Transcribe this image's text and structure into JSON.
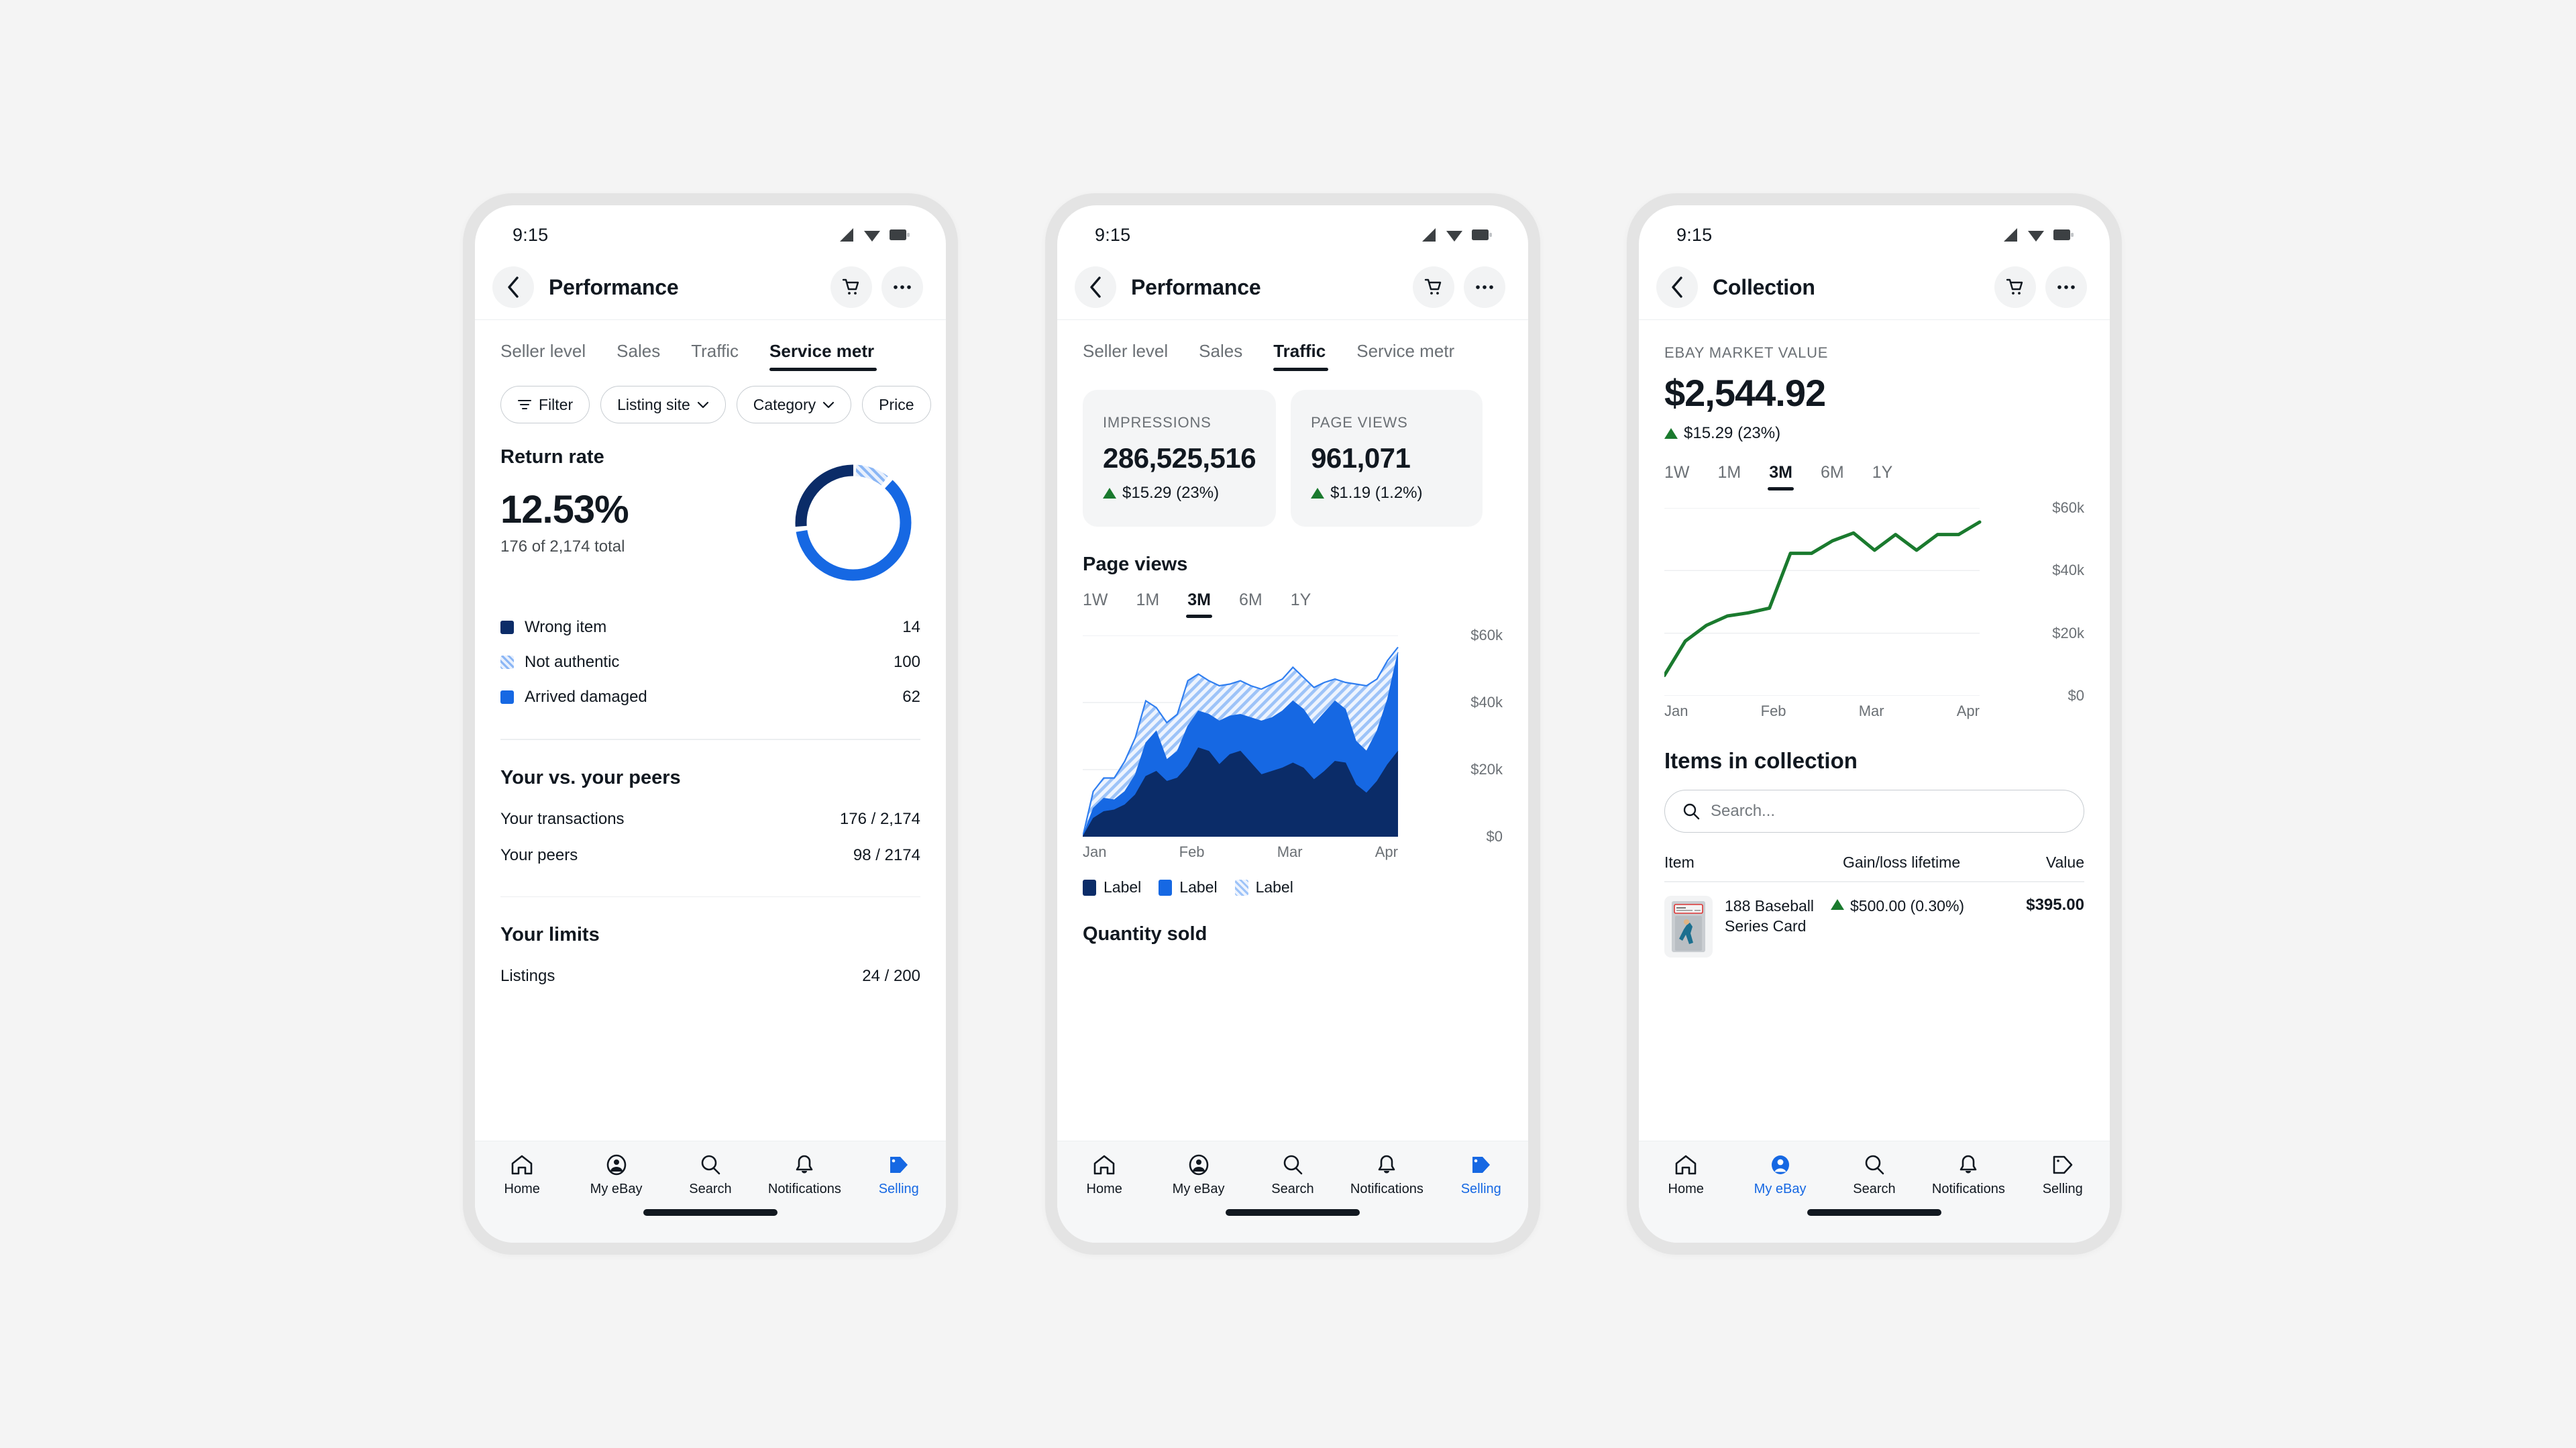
{
  "status_bar": {
    "time": "9:15",
    "icons": [
      "signal-icon",
      "wifi-icon",
      "battery-icon"
    ]
  },
  "colors": {
    "navy": "#0b2c68",
    "blue": "#1668e3",
    "hatch_light": "#cfe0fb",
    "green": "#1a7a2e",
    "text": "#111820",
    "muted": "#6b7075"
  },
  "bottom_nav": {
    "items": [
      {
        "label": "Home",
        "icon": "home-icon"
      },
      {
        "label": "My eBay",
        "icon": "account-icon"
      },
      {
        "label": "Search",
        "icon": "search-icon"
      },
      {
        "label": "Notifications",
        "icon": "bell-icon"
      },
      {
        "label": "Selling",
        "icon": "tag-icon"
      }
    ],
    "active_phone1": "Selling",
    "active_phone2": "Selling",
    "active_phone3": "My eBay"
  },
  "phone1": {
    "appbar": {
      "back": "back-icon",
      "title": "Performance",
      "cart": "cart-icon",
      "more": "more-icon"
    },
    "tabs": [
      {
        "label": "Seller level",
        "active": false
      },
      {
        "label": "Sales",
        "active": false
      },
      {
        "label": "Traffic",
        "active": false
      },
      {
        "label": "Service metr",
        "active": true
      }
    ],
    "chips": [
      {
        "label": "Filter",
        "icon": "filter-icon",
        "caret": false
      },
      {
        "label": "Listing site",
        "icon": "",
        "caret": true
      },
      {
        "label": "Category",
        "icon": "",
        "caret": true
      },
      {
        "label": "Price",
        "icon": "",
        "caret": false
      }
    ],
    "return_rate": {
      "title": "Return rate",
      "percent": "12.53%",
      "subtitle": "176 of 2,174 total",
      "legend": [
        {
          "label": "Wrong item",
          "value": "14",
          "swatch": "navy"
        },
        {
          "label": "Not authentic",
          "value": "100",
          "swatch": "hatch"
        },
        {
          "label": "Arrived damaged",
          "value": "62",
          "swatch": "blue"
        }
      ]
    },
    "peers": {
      "title": "Your vs. your peers",
      "rows": [
        {
          "label": "Your transactions",
          "value": "176 / 2,174"
        },
        {
          "label": "Your peers",
          "value": "98 / 2174"
        }
      ]
    },
    "limits": {
      "title": "Your limits",
      "rows": [
        {
          "label": "Listings",
          "value": "24 / 200"
        }
      ]
    },
    "chart_data": {
      "type": "pie",
      "title": "Return rate",
      "labels": [
        "Wrong item",
        "Not authentic",
        "Arrived damaged"
      ],
      "values": [
        14,
        100,
        62
      ],
      "total": 176,
      "total_transactions": 2174,
      "percent_of_total": 12.53,
      "colors": [
        "#0b2c68",
        "#cfe0fb",
        "#1668e3"
      ],
      "donut": true
    }
  },
  "phone2": {
    "appbar": {
      "back": "back-icon",
      "title": "Performance",
      "cart": "cart-icon",
      "more": "more-icon"
    },
    "tabs": [
      {
        "label": "Seller level",
        "active": false
      },
      {
        "label": "Sales",
        "active": false
      },
      {
        "label": "Traffic",
        "active": true
      },
      {
        "label": "Service metr",
        "active": false
      }
    ],
    "stats": [
      {
        "label": "IMPRESSIONS",
        "value": "286,525,516",
        "delta": "$15.29 (23%)",
        "direction": "up"
      },
      {
        "label": "PAGE VIEWS",
        "value": "961,071",
        "delta": "$1.19 (1.2%)",
        "direction": "up"
      }
    ],
    "page_views": {
      "title": "Page views",
      "ranges": [
        "1W",
        "1M",
        "3M",
        "6M",
        "1Y"
      ],
      "active_range": "3M",
      "legend": [
        {
          "label": "Label",
          "swatch": "navy"
        },
        {
          "label": "Label",
          "swatch": "blue"
        },
        {
          "label": "Label",
          "swatch": "hatch"
        }
      ]
    },
    "quantity_sold": {
      "title": "Quantity sold"
    },
    "chart_data": {
      "type": "area",
      "title": "Page views",
      "stacked": true,
      "xlabel": "",
      "ylabel": "",
      "ylim": [
        0,
        60000
      ],
      "yticks": [
        0,
        20000,
        40000,
        60000
      ],
      "ytick_labels": [
        "$0",
        "$20k",
        "$40k",
        "$60k"
      ],
      "xtick_labels": [
        "Jan",
        "Feb",
        "Mar",
        "Apr"
      ],
      "grid": true,
      "legend_position": "below",
      "x": [
        0,
        1,
        2,
        3,
        4,
        5,
        6,
        7,
        8,
        9,
        10,
        11,
        12,
        13,
        14,
        15,
        16,
        17,
        18,
        19,
        20,
        21,
        22,
        23,
        24,
        25,
        26,
        27,
        28,
        29,
        30
      ],
      "series": [
        {
          "name": "Label",
          "color": "#0b2c68",
          "values": [
            0,
            5500,
            7500,
            8000,
            9500,
            12500,
            18000,
            19500,
            16500,
            17500,
            21000,
            26500,
            25500,
            21500,
            24500,
            25500,
            22000,
            18500,
            19500,
            20500,
            22000,
            20500,
            17000,
            19500,
            22500,
            22000,
            15500,
            13000,
            16500,
            21500,
            25500
          ]
        },
        {
          "name": "Label",
          "color": "#1668e3",
          "values": [
            0,
            8500,
            11500,
            11000,
            13500,
            18500,
            28000,
            31500,
            23000,
            25500,
            33000,
            37500,
            36500,
            34500,
            36000,
            36500,
            35500,
            34500,
            35500,
            37500,
            40500,
            38000,
            33500,
            37000,
            40500,
            38000,
            28500,
            25500,
            31500,
            41000,
            55000
          ]
        },
        {
          "name": "Label",
          "color": "#cfe0fb",
          "hatched": true,
          "values": [
            0,
            13500,
            17500,
            17500,
            22500,
            29500,
            40500,
            38500,
            34000,
            36500,
            46500,
            48500,
            46500,
            45000,
            45500,
            46500,
            45000,
            44000,
            45500,
            47000,
            50500,
            47500,
            44500,
            46000,
            47000,
            46000,
            45500,
            45000,
            47000,
            52500,
            56500
          ]
        }
      ]
    }
  },
  "phone3": {
    "appbar": {
      "back": "back-icon",
      "title": "Collection",
      "cart": "cart-icon",
      "more": "more-icon"
    },
    "market_value": {
      "label": "EBAY MARKET VALUE",
      "value": "$2,544.92",
      "delta": "$15.29 (23%)",
      "direction": "up"
    },
    "ranges": [
      "1W",
      "1M",
      "3M",
      "6M",
      "1Y"
    ],
    "active_range": "3M",
    "items_section": {
      "title": "Items in collection",
      "search_placeholder": "Search...",
      "search_value": "",
      "search_icon": "search-icon",
      "columns": [
        "Item",
        "Gain/loss lifetime",
        "Value"
      ],
      "rows": [
        {
          "name": "188 Baseball Series Card",
          "gain": "$500.00 (0.30%)",
          "direction": "up",
          "value": "$395.00",
          "thumb": "graded-card-thumbnail"
        }
      ]
    },
    "chart_data": {
      "type": "line",
      "title": "eBay market value",
      "xlabel": "",
      "ylabel": "",
      "ylim": [
        0,
        60000
      ],
      "yticks": [
        0,
        20000,
        40000,
        60000
      ],
      "ytick_labels": [
        "$0",
        "$20k",
        "$40k",
        "$60k"
      ],
      "xtick_labels": [
        "Jan",
        "Feb",
        "Mar",
        "Apr"
      ],
      "grid": true,
      "color": "#1a7a2e",
      "x": [
        0,
        1,
        2,
        3,
        4,
        5,
        6,
        7,
        8,
        9,
        10,
        11,
        12,
        13,
        14
      ],
      "values": [
        6500,
        17500,
        22500,
        25500,
        26500,
        28000,
        45500,
        45500,
        49500,
        52000,
        46500,
        51500,
        46500,
        51500,
        51500,
        55500
      ]
    }
  }
}
